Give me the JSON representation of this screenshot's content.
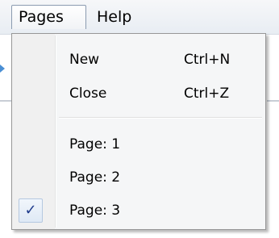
{
  "menubar": {
    "items": [
      {
        "label": "Pages"
      },
      {
        "label": "Help"
      }
    ]
  },
  "dropdown": {
    "items": [
      {
        "label": "New",
        "shortcut": "Ctrl+N"
      },
      {
        "label": "Close",
        "shortcut": "Ctrl+Z"
      },
      {
        "label": "Page: 1"
      },
      {
        "label": "Page: 2"
      },
      {
        "label": "Page: 3",
        "checked": true,
        "check_glyph": "✓"
      }
    ]
  },
  "colors": {
    "check": "#1f3b8c",
    "menu_bg": "#f5f6f7",
    "menubar_bg": "#e8edf3",
    "border": "#979797"
  }
}
